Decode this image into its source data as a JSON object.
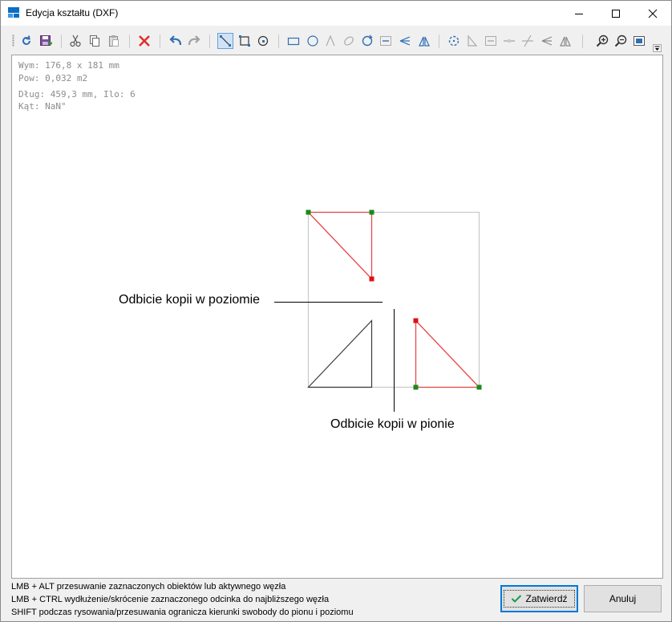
{
  "window": {
    "title": "Edycja kształtu (DXF)",
    "controls": [
      "minimize",
      "maximize",
      "close"
    ]
  },
  "toolbar": {
    "tools": [
      {
        "icon": "refresh-icon",
        "pressed": false
      },
      {
        "icon": "save-icon",
        "pressed": false
      },
      {
        "icon": "cut-icon",
        "pressed": false
      },
      {
        "icon": "copy-icon",
        "pressed": false
      },
      {
        "icon": "paste-icon",
        "pressed": false
      },
      {
        "icon": "delete-icon",
        "pressed": false
      },
      {
        "icon": "undo-icon",
        "pressed": false
      },
      {
        "icon": "redo-icon",
        "pressed": false
      },
      {
        "icon": "line-tool-icon",
        "pressed": true
      },
      {
        "icon": "polyline-tool-icon",
        "pressed": false
      },
      {
        "icon": "arc-tool-icon",
        "pressed": false
      },
      {
        "icon": "rectangle-tool-icon",
        "pressed": false
      },
      {
        "icon": "circle-tool-icon",
        "pressed": false
      },
      {
        "icon": "angle-tool-icon",
        "pressed": false
      },
      {
        "icon": "ellipse-tool-icon",
        "pressed": false
      },
      {
        "icon": "rotate-tool-icon",
        "pressed": false
      },
      {
        "icon": "move-tool-icon",
        "pressed": false
      },
      {
        "icon": "scale-tool-icon",
        "pressed": false
      },
      {
        "icon": "mirror-tool-icon",
        "pressed": false
      },
      {
        "icon": "rotate-selection-icon",
        "pressed": false
      },
      {
        "icon": "extend-icon",
        "pressed": false
      },
      {
        "icon": "distance-icon",
        "pressed": false
      },
      {
        "icon": "split-icon",
        "pressed": false
      },
      {
        "icon": "trim-icon",
        "pressed": false
      },
      {
        "icon": "flip-icon",
        "pressed": false
      },
      {
        "icon": "mirror-copy-icon",
        "pressed": false
      },
      {
        "icon": "zoom-in-icon",
        "pressed": false
      },
      {
        "icon": "zoom-out-icon",
        "pressed": false
      },
      {
        "icon": "zoom-fit-icon",
        "pressed": false
      }
    ]
  },
  "info": {
    "dimensions": "Wym: 176,8 x 181 mm",
    "area": "Pow: 0,032 m2",
    "length": "Dług: 459,3 mm, Ilo: 6",
    "angle": "Kąt: NaN°"
  },
  "annotations": {
    "horizontal": "Odbicie kopii w poziomie",
    "vertical": "Odbicie kopii w pionie"
  },
  "colors": {
    "selected_line": "#e8474a",
    "shape_line": "#3a3a3a",
    "bounding_box": "#c8c8c8",
    "node_green": "#1a8a1a",
    "node_red": "#e01010",
    "accent": "#0078d7"
  },
  "hints": [
    "LMB + ALT przesuwanie zaznaczonych obiektów lub aktywnego węzła",
    "LMB + CTRL wydłużenie/skrócenie zaznaczonego odcinka do najbliższego węzła",
    "SHIFT podczas rysowania/przesuwania ogranicza kierunki swobody do pionu i poziomu"
  ],
  "buttons": {
    "confirm": "Zatwierdź",
    "cancel": "Anuluj"
  }
}
